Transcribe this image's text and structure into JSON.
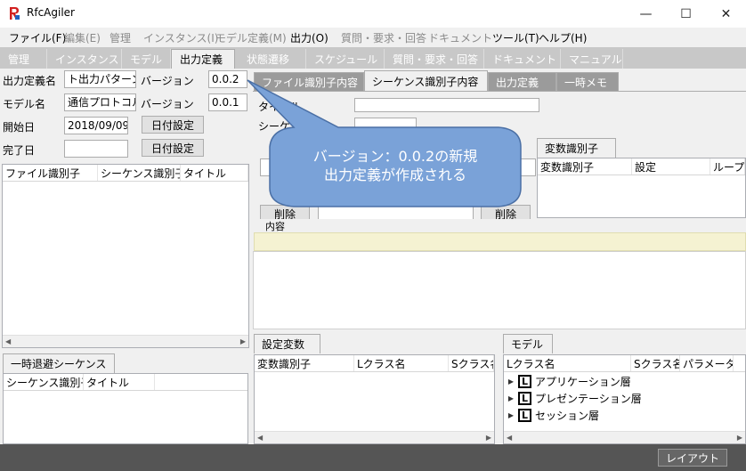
{
  "app": {
    "title": "RfcAgiler"
  },
  "window_controls": {
    "minimize": "—",
    "maximize": "☐",
    "close": "✕"
  },
  "menu": [
    {
      "label": "ファイル(F)",
      "enabled": true
    },
    {
      "label": "編集(E)",
      "enabled": false
    },
    {
      "label": "管理",
      "enabled": false
    },
    {
      "label": "インスタンス(I)",
      "enabled": false
    },
    {
      "label": "モデル定義(M)",
      "enabled": false
    },
    {
      "label": "出力(O)",
      "enabled": true
    },
    {
      "label": "質問・要求・回答",
      "enabled": false
    },
    {
      "label": "ドキュメント",
      "enabled": false
    },
    {
      "label": "ツール(T)",
      "enabled": true
    },
    {
      "label": "ヘルプ(H)",
      "enabled": true
    }
  ],
  "main_tabs": [
    "管理",
    "インスタンス",
    "モデル",
    "出力定義",
    "状態遷移",
    "スケジュール",
    "質問・要求・回答",
    "ドキュメント",
    "マニュアル"
  ],
  "main_tab_active": "出力定義",
  "form": {
    "output_def_label": "出力定義名",
    "output_def_value": "ト出力パターン",
    "version_label": "バージョン",
    "version_value": "0.0.2",
    "model_label": "モデル名",
    "model_value": "通信プロトコル",
    "model_version_label": "バージョン",
    "model_version_value": "0.0.1",
    "start_label": "開始日",
    "start_value": "2018/09/09",
    "end_label": "完了日",
    "end_value": "",
    "date_button": "日付設定"
  },
  "left_table": {
    "headers": [
      "ファイル識別子",
      "シーケンス識別子",
      "タイトル"
    ]
  },
  "temp_seq": {
    "tab": "一時退避シーケンス",
    "headers": [
      "シーケンス識別子",
      "タイトル"
    ]
  },
  "right_tabs": [
    "ファイル識別子内容",
    "シーケンス識別子内容",
    "出力定義",
    "一時メモ"
  ],
  "right_tab_active": "シーケンス識別子内容",
  "seq_form": {
    "title_label": "タイトル",
    "seq_label": "シーケンス",
    "delete_button": "削除"
  },
  "var_id": {
    "tab": "変数識別子",
    "headers": [
      "変数識別子",
      "設定",
      "ループ"
    ]
  },
  "content_label": "内容",
  "settings_var": {
    "tab": "設定変数",
    "headers": [
      "変数識別子",
      "Lクラス名",
      "Sクラス名"
    ]
  },
  "model_panel": {
    "tab": "モデル",
    "headers": [
      "Lクラス名",
      "Sクラス名",
      "パラメータ"
    ],
    "items": [
      "アプリケーション層",
      "プレゼンテーション層",
      "セッション層"
    ],
    "item_icon": "L"
  },
  "callout": {
    "line1": "バージョン：0.0.2の新規",
    "line2": "出力定義が作成される"
  },
  "status": {
    "layout_button": "レイアウト"
  },
  "colors": {
    "callout_fill": "#7aa2d8",
    "callout_border": "#4a6fa5",
    "content_bar": "#f5f2d2",
    "active_tab_dark": "#9b9b9b"
  }
}
